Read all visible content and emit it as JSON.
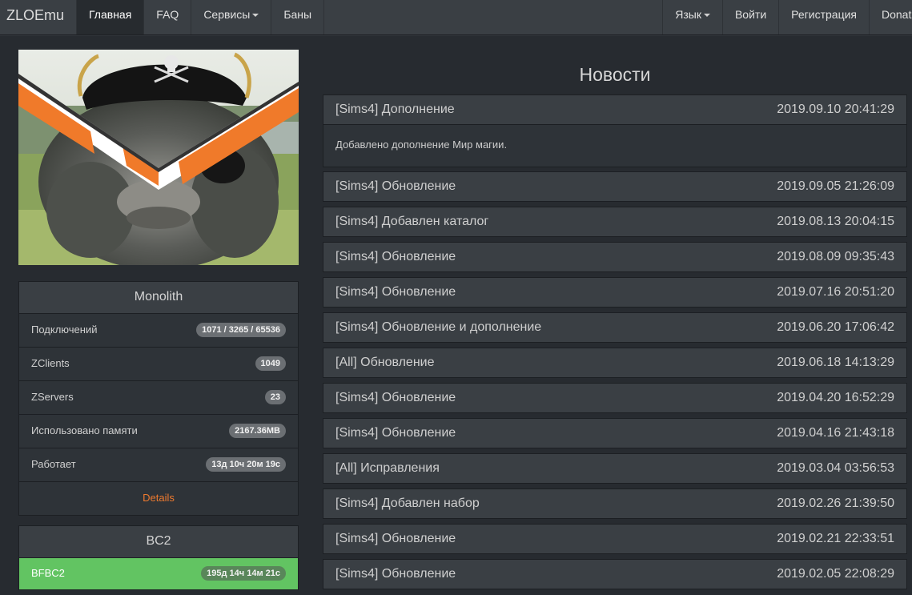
{
  "nav": {
    "brand": "ZLOEmu",
    "left": [
      "Главная",
      "FAQ",
      "Сервисы",
      "Баны"
    ],
    "lang_label": "Язык",
    "login_label": "Войти",
    "register_label": "Регистрация",
    "donate_label": "Donat"
  },
  "monolith": {
    "title": "Monolith",
    "rows": [
      {
        "label": "Подключений",
        "value": "1071 / 3265 / 65536"
      },
      {
        "label": "ZClients",
        "value": "1049"
      },
      {
        "label": "ZServers",
        "value": "23"
      },
      {
        "label": "Использовано памяти",
        "value": "2167.36MB"
      },
      {
        "label": "Работает",
        "value": "13д 10ч 20м 19с"
      }
    ],
    "details_label": "Details"
  },
  "bc2": {
    "title": "BC2",
    "row": {
      "label": "BFBC2",
      "value": "195д 14ч 14м 21с"
    }
  },
  "news": {
    "title": "Новости",
    "items": [
      {
        "title": "[Sims4] Дополнение",
        "date": "2019.09.10 20:41:29",
        "body": "Добавлено дополнение Мир магии."
      },
      {
        "title": "[Sims4] Обновление",
        "date": "2019.09.05 21:26:09"
      },
      {
        "title": "[Sims4] Добавлен каталог",
        "date": "2019.08.13 20:04:15"
      },
      {
        "title": "[Sims4] Обновление",
        "date": "2019.08.09 09:35:43"
      },
      {
        "title": "[Sims4] Обновление",
        "date": "2019.07.16 20:51:20"
      },
      {
        "title": "[Sims4] Обновление и дополнение",
        "date": "2019.06.20 17:06:42"
      },
      {
        "title": "[All] Обновление",
        "date": "2019.06.18 14:13:29"
      },
      {
        "title": "[Sims4] Обновление",
        "date": "2019.04.20 16:52:29"
      },
      {
        "title": "[Sims4] Обновление",
        "date": "2019.04.16 21:43:18"
      },
      {
        "title": "[All] Исправления",
        "date": "2019.03.04 03:56:53"
      },
      {
        "title": "[Sims4] Добавлен набор",
        "date": "2019.02.26 21:39:50"
      },
      {
        "title": "[Sims4] Обновление",
        "date": "2019.02.21 22:33:51"
      },
      {
        "title": "[Sims4] Обновление",
        "date": "2019.02.05 22:08:29"
      }
    ]
  },
  "colors": {
    "page_bg": "#272b30",
    "navbar_bg": "#3a3f44",
    "panel_bg": "#2e3338",
    "accent_orange": "#ee7a2f",
    "success_green": "#62c462"
  }
}
